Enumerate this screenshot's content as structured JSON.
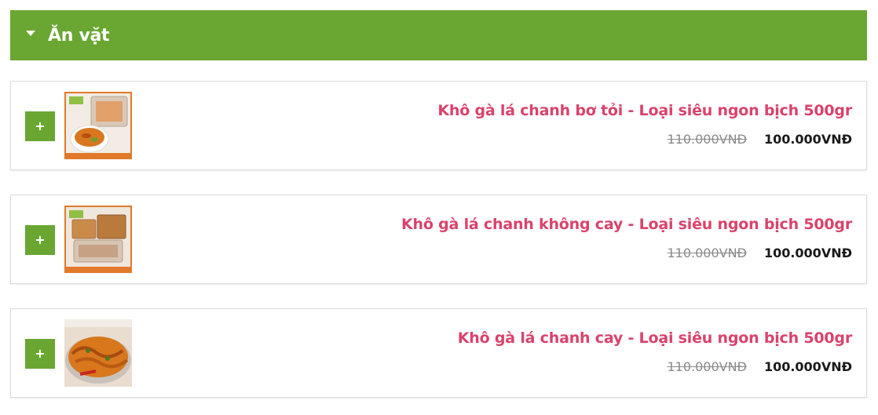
{
  "category": {
    "title": "Ăn vặt",
    "icon": "caret-down-icon",
    "color": "#6aa632"
  },
  "products": [
    {
      "name": "Khô gà lá chanh bơ tỏi - Loại siêu ngon bịch 500gr",
      "old_price": "110.000VNĐ",
      "price": "100.000VNĐ",
      "add_label": "+",
      "image": "dried-chicken-bowl-photo"
    },
    {
      "name": "Khô gà lá chanh không cay - Loại siêu ngon bịch 500gr",
      "old_price": "110.000VNĐ",
      "price": "100.000VNĐ",
      "add_label": "+",
      "image": "dried-chicken-bags-photo"
    },
    {
      "name": "Khô gà lá chanh cay - Loại siêu ngon bịch 500gr",
      "old_price": "110.000VNĐ",
      "price": "100.000VNĐ",
      "add_label": "+",
      "image": "spicy-dried-chicken-plate-photo"
    }
  ],
  "colors": {
    "accent": "#6aa632",
    "product_name": "#d9436b",
    "old_price": "#8a8a8a",
    "price": "#1a1a1a"
  }
}
